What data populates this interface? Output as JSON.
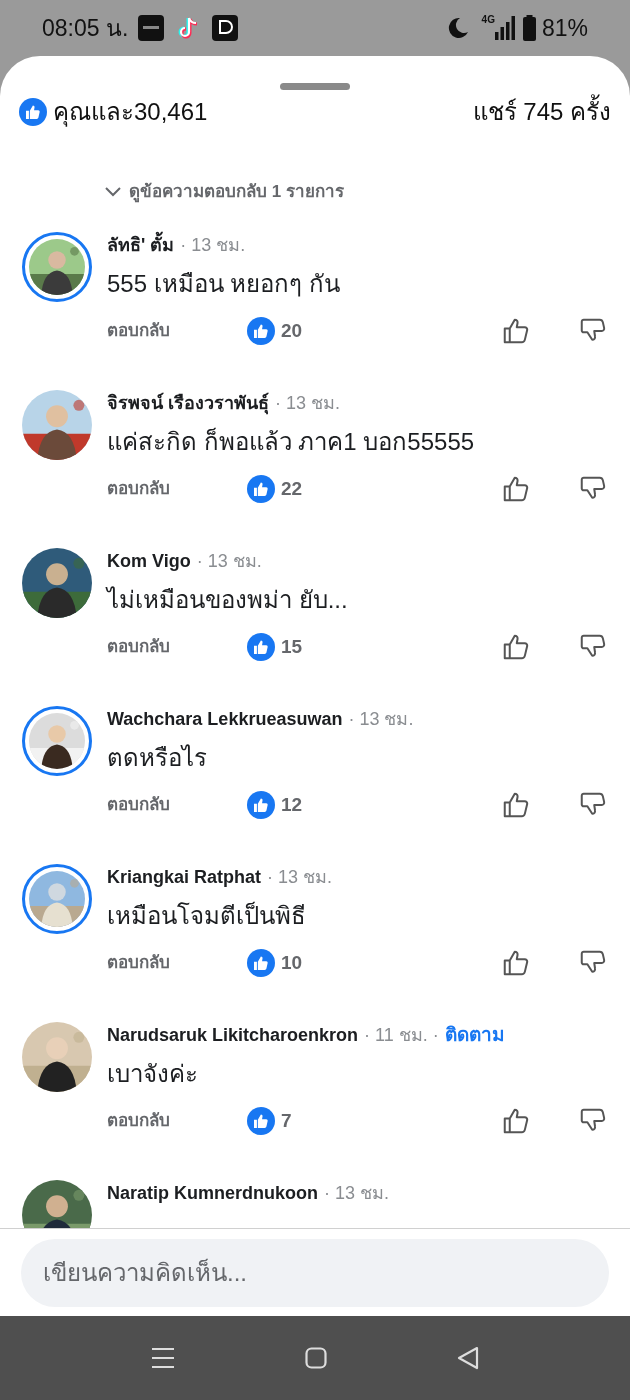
{
  "status_bar": {
    "time": "08:05 น.",
    "battery": "81%",
    "network": "4G"
  },
  "header": {
    "reactions": "คุณและ30,461",
    "shares": "แชร์ 745 ครั้ง"
  },
  "view_replies": "ดูข้อความตอบกลับ 1 รายการ",
  "comments": [
    {
      "name": "ลัทธิ' ตั้ม",
      "time": "· 13 ชม.",
      "text": "555 เหมือน หยอกๆ กัน",
      "story_ring": true,
      "reply": "ตอบกลับ",
      "likes": "20"
    },
    {
      "name": "จิรพจน์ เรืองวราพันธุ์",
      "time": "· 13 ชม.",
      "text": "แค่สะกิด ก็พอแล้ว ภาค1 บอก55555",
      "story_ring": false,
      "reply": "ตอบกลับ",
      "likes": "22"
    },
    {
      "name": "Kom Vigo",
      "time": "· 13 ชม.",
      "text": "ไม่เหมือนของพม่า ยับ...",
      "story_ring": false,
      "reply": "ตอบกลับ",
      "likes": "15"
    },
    {
      "name": "Wachchara Lekkrueasuwan",
      "time": "· 13 ชม.",
      "text": "ตดหรือไร",
      "story_ring": true,
      "reply": "ตอบกลับ",
      "likes": "12"
    },
    {
      "name": "Kriangkai Ratphat",
      "time": "· 13 ชม.",
      "text": "เหมือนโจมตีเป็นพิธี",
      "story_ring": true,
      "reply": "ตอบกลับ",
      "likes": "10"
    },
    {
      "name": "Narudsaruk Likitcharoenkron",
      "time": "· 11 ชม. ·",
      "follow": "ติดตาม",
      "text": "เบาจังค่ะ",
      "story_ring": false,
      "reply": "ตอบกลับ",
      "likes": "7"
    },
    {
      "name": "Naratip Kumnerdnukoon",
      "time": "· 13 ชม.",
      "story_ring": false
    }
  ],
  "comment_field": {
    "placeholder": "เขียนความคิดเห็น..."
  }
}
